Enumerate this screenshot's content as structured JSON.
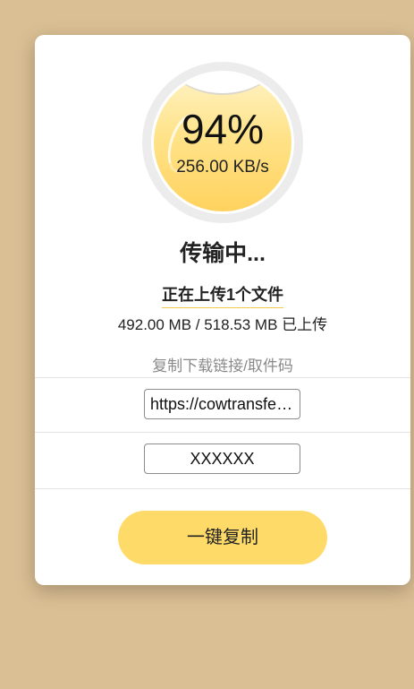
{
  "progress": {
    "percent_label": "94%",
    "percent_value": 94,
    "speed": "256.00 KB/s"
  },
  "status": {
    "title": "传输中...",
    "uploading_text": "正在上传1个文件",
    "size_text": "492.00 MB / 518.53 MB 已上传"
  },
  "share": {
    "label": "复制下载链接/取件码",
    "link_value": "https://cowtransfer.com/s/",
    "code_value": "XXXXXX"
  },
  "actions": {
    "copy_button_label": "一键复制"
  },
  "colors": {
    "page_background": "#dbbf94",
    "accent_yellow": "#fedb69"
  }
}
